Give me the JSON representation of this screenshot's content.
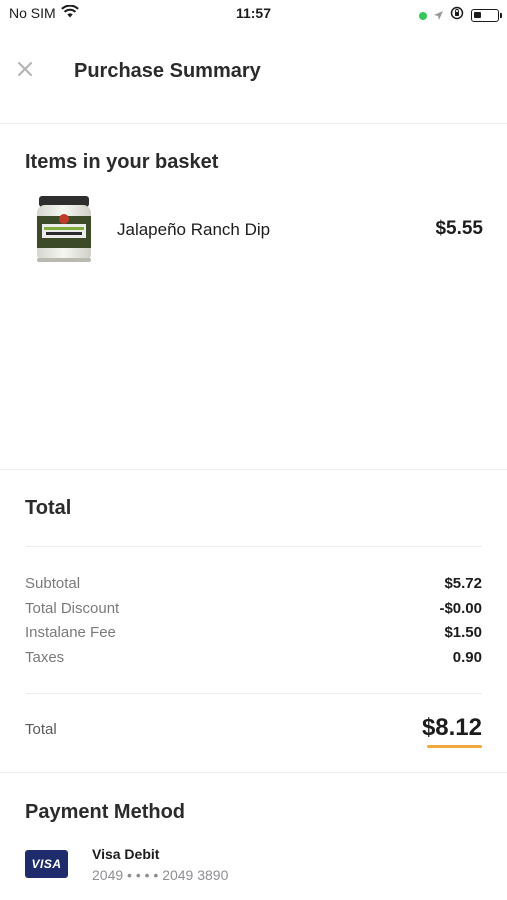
{
  "status_bar": {
    "carrier": "No SIM",
    "time": "11:57",
    "battery_level": 0.35
  },
  "header": {
    "title": "Purchase Summary",
    "close_icon": "close-icon"
  },
  "basket": {
    "title": "Items in your basket",
    "items": [
      {
        "name": "Jalapeño Ranch Dip",
        "price": "$5.55",
        "image_icon": "product-jar-image"
      }
    ]
  },
  "totals": {
    "title": "Total",
    "lines": [
      {
        "label": "Subtotal",
        "value": "$5.72"
      },
      {
        "label": "Total Discount",
        "value": "-$0.00"
      },
      {
        "label": "Instalane Fee",
        "value": "$1.50"
      },
      {
        "label": "Taxes",
        "value": "0.90"
      }
    ],
    "total_label": "Total",
    "total_value": "$8.12",
    "accent_color": "#f0a93c"
  },
  "payment": {
    "title": "Payment Method",
    "card_brand": "VISA",
    "card_name": "Visa Debit",
    "card_number": "2049 • • • • 2049 3890"
  }
}
